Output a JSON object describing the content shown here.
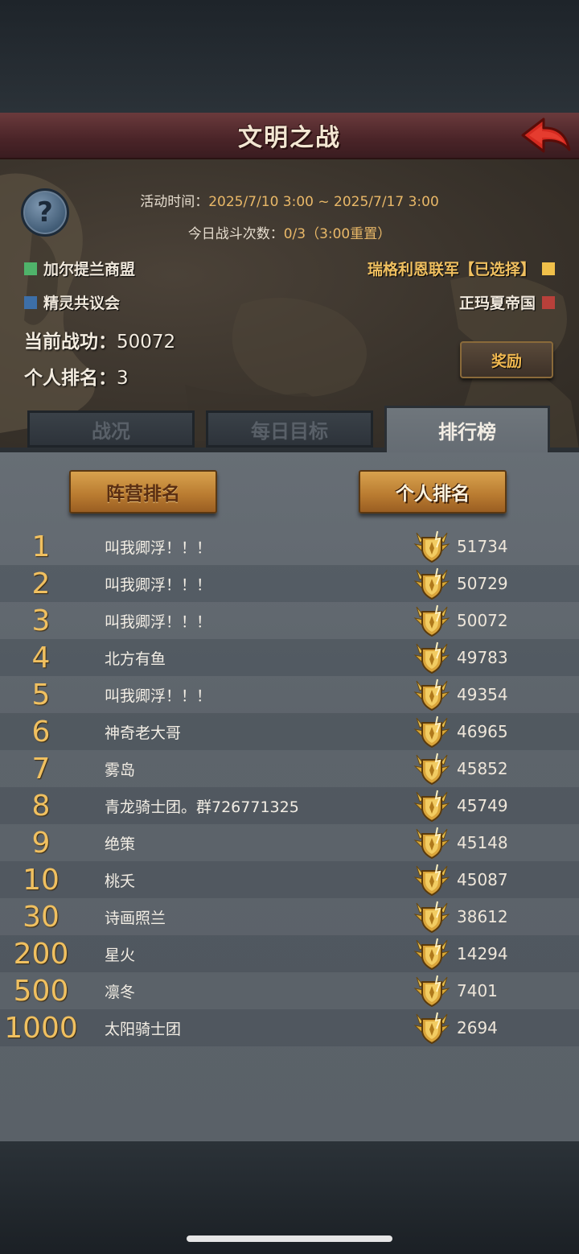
{
  "title": "文明之战",
  "info": {
    "time_label": "活动时间：",
    "time_value": "2025/7/10 3:00 ~ 2025/7/17 3:00",
    "count_label": "今日战斗次数：",
    "count_value": "0/3（3:00重置）"
  },
  "factions": {
    "green": {
      "name": "加尔提兰商盟",
      "color": "#4fb36a"
    },
    "blue": {
      "name": "精灵共议会",
      "color": "#3d6fa8"
    },
    "yellow": {
      "name": "瑞格利恩联军【已选择】",
      "color": "#f0c04a"
    },
    "red": {
      "name": "正玛夏帝国",
      "color": "#b8403a"
    }
  },
  "stats": {
    "merit_label": "当前战功：",
    "merit_value": "50072",
    "rank_label": "个人排名：",
    "rank_value": "3"
  },
  "reward_label": "奖励",
  "tabs": [
    "战况",
    "每日目标",
    "排行榜"
  ],
  "active_tab": "排行榜",
  "sub_tabs": {
    "camp": "阵营排名",
    "personal": "个人排名"
  },
  "active_sub_tab": "个人排名",
  "ranking": [
    {
      "rank": "1",
      "name": "叫我卿浮！！！",
      "score": "51734"
    },
    {
      "rank": "2",
      "name": "叫我卿浮！！！",
      "score": "50729"
    },
    {
      "rank": "3",
      "name": "叫我卿浮！！！",
      "score": "50072"
    },
    {
      "rank": "4",
      "name": "北方有鱼",
      "score": "49783"
    },
    {
      "rank": "5",
      "name": "叫我卿浮！！！",
      "score": "49354"
    },
    {
      "rank": "6",
      "name": "神奇老大哥",
      "score": "46965"
    },
    {
      "rank": "7",
      "name": "雾岛",
      "score": "45852"
    },
    {
      "rank": "8",
      "name": "青龙骑士团。群726771325",
      "score": "45749"
    },
    {
      "rank": "9",
      "name": "绝策",
      "score": "45148"
    },
    {
      "rank": "10",
      "name": "桃夭",
      "score": "45087"
    },
    {
      "rank": "30",
      "name": "诗画照兰",
      "score": "38612"
    },
    {
      "rank": "200",
      "name": "星火",
      "score": "14294"
    },
    {
      "rank": "500",
      "name": "凛冬",
      "score": "7401"
    },
    {
      "rank": "1000",
      "name": "太阳骑士团",
      "score": "2694"
    }
  ],
  "icons": {
    "back": "back-arrow-icon",
    "help": "question-mark-icon",
    "badge": "rank-shield-badge-icon"
  }
}
